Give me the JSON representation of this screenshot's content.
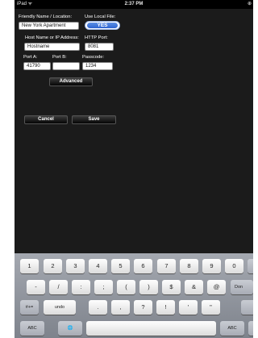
{
  "statusbar": {
    "carrier": "iPad ᯤ",
    "time": "2:37 PM",
    "indicator": "⊕"
  },
  "form": {
    "friendly_name_label": "Friendly Name / Location:",
    "friendly_name_value": "New York Apartment",
    "use_local_file_label": "Use Local File:",
    "use_local_file_value": "YES",
    "host_label": "Host Name or IP Address:",
    "host_value": "Hostname",
    "http_port_label": "HTTP Port:",
    "http_port_value": "8081",
    "port_a_label": "Port A:",
    "port_a_value": "41790",
    "port_b_label": "Port B:",
    "port_b_value": "",
    "passcode_label": "Passcode:",
    "passcode_value": "1234"
  },
  "buttons": {
    "advanced": "Advanced",
    "cancel": "Cancel",
    "save": "Save"
  },
  "keyboard": {
    "row1": [
      "1",
      "2",
      "3",
      "4",
      "5",
      "6",
      "7",
      "8",
      "9",
      "0"
    ],
    "row2": [
      "-",
      "/",
      ":",
      ";",
      "(",
      ")",
      "$",
      "&",
      "@",
      "Don"
    ],
    "row3": [
      "#+=",
      "undo",
      ".",
      ",",
      "?",
      "!",
      "'",
      "\""
    ],
    "row4": {
      "abc_left": "ABC",
      "globe": "🌐",
      "abc_right": "ABC"
    }
  }
}
